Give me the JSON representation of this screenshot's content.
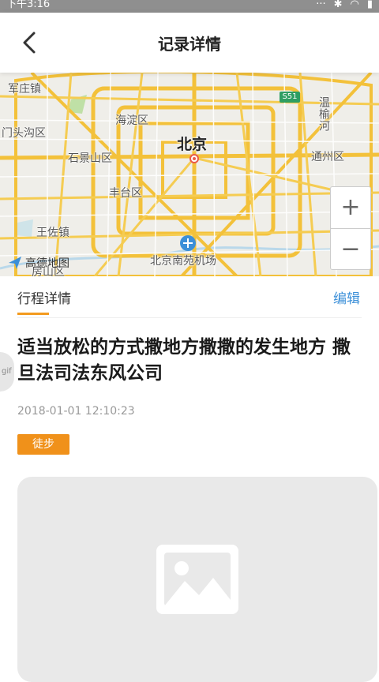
{
  "status_bar": {
    "time": "下午3:16",
    "icons": [
      "dots-icon",
      "bluetooth-icon",
      "wifi-icon",
      "signal-icon"
    ]
  },
  "header": {
    "title": "记录详情",
    "back_icon": "chevron-left-icon"
  },
  "map": {
    "labels": {
      "junzhuang": "军庄镇",
      "mentougou": "门头沟区",
      "haidian": "海淀区",
      "shijingshan": "石景山区",
      "beijing": "北京",
      "fengtai": "丰台区",
      "wangzuo": "王佐镇",
      "fangshan": "房山区",
      "nanyuan_airport": "北京南苑机场",
      "wenyu": "温榆河",
      "tongzhou": "通州区",
      "route": "S51"
    },
    "logo_text": "高德地图",
    "zoom_in": "+",
    "zoom_out": "−"
  },
  "tabs": {
    "trip_details": "行程详情",
    "edit": "编辑"
  },
  "record": {
    "title": "适当放松的方式撒地方撒撒的发生地方 撒旦法司法东风公司",
    "date": "2018-01-01 12:10:23",
    "mode": "徒步"
  },
  "side_handle": {
    "label": "gif"
  },
  "colors": {
    "accent": "#f39b1f",
    "link": "#3b8fd8",
    "badge": "#f0911a"
  }
}
